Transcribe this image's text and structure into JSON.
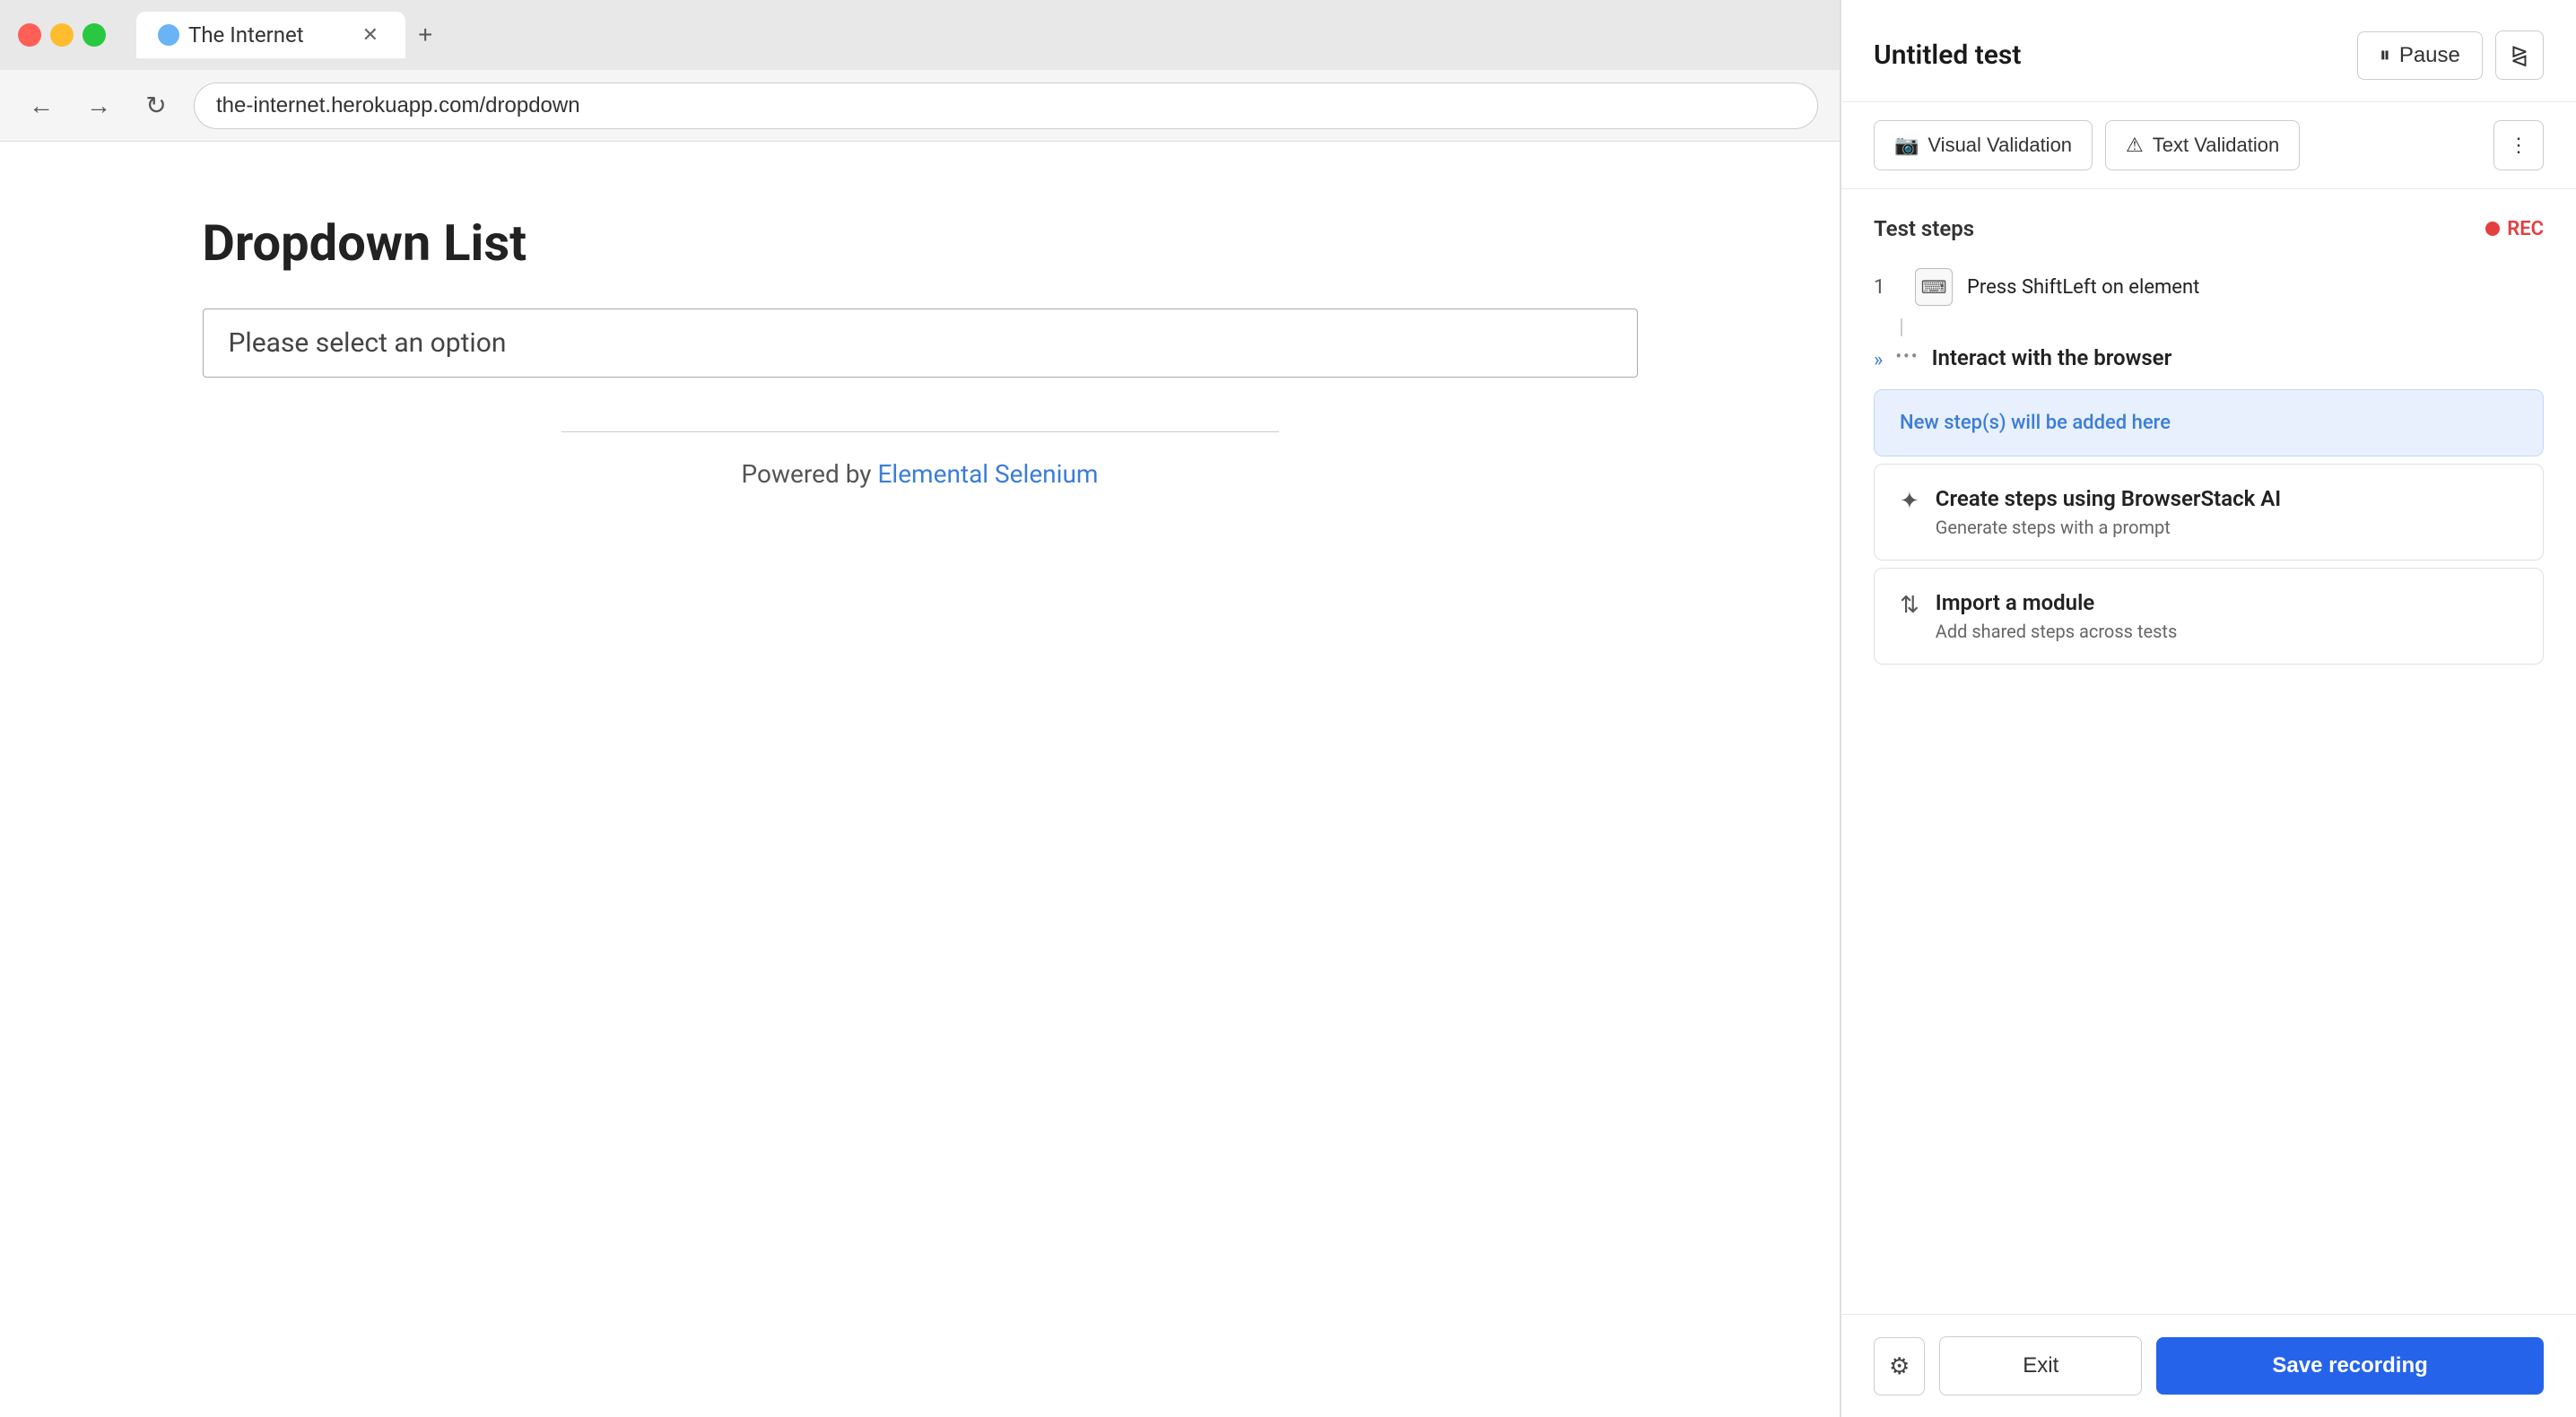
{
  "browser": {
    "tab": {
      "title": "The Internet",
      "icon": "globe-icon"
    },
    "new_tab_label": "+",
    "nav": {
      "back_label": "‹",
      "forward_label": "›",
      "refresh_label": "↻"
    },
    "url": "the-internet.herokuapp.com/dropdown",
    "page": {
      "heading": "Dropdown List",
      "dropdown_placeholder": "Please select an option",
      "powered_by_text": "Powered by ",
      "powered_by_link": "Elemental Selenium",
      "powered_by_href": "#"
    }
  },
  "panel": {
    "title": "Untitled test",
    "pause_label": "Pause",
    "expand_label": "⤢",
    "toolbar": {
      "visual_validation_label": "Visual Validation",
      "text_validation_label": "Text Validation",
      "more_label": "⋮"
    },
    "test_steps_label": "Test steps",
    "rec_label": "REC",
    "steps": [
      {
        "number": "1",
        "icon": "⌨",
        "text": "Press ShiftLeft on element"
      }
    ],
    "interact_label": "Interact with the browser",
    "cards": {
      "new_step": {
        "text": "New step(s) will be added here"
      },
      "ai_step": {
        "title": "Create steps using BrowserStack AI",
        "subtitle": "Generate steps with a prompt",
        "icon": "✦"
      },
      "import_module": {
        "title": "Import a module",
        "subtitle": "Add shared steps across tests",
        "icon": "⇅"
      }
    },
    "footer": {
      "settings_icon": "⚙",
      "exit_label": "Exit",
      "save_recording_label": "Save recording"
    }
  }
}
